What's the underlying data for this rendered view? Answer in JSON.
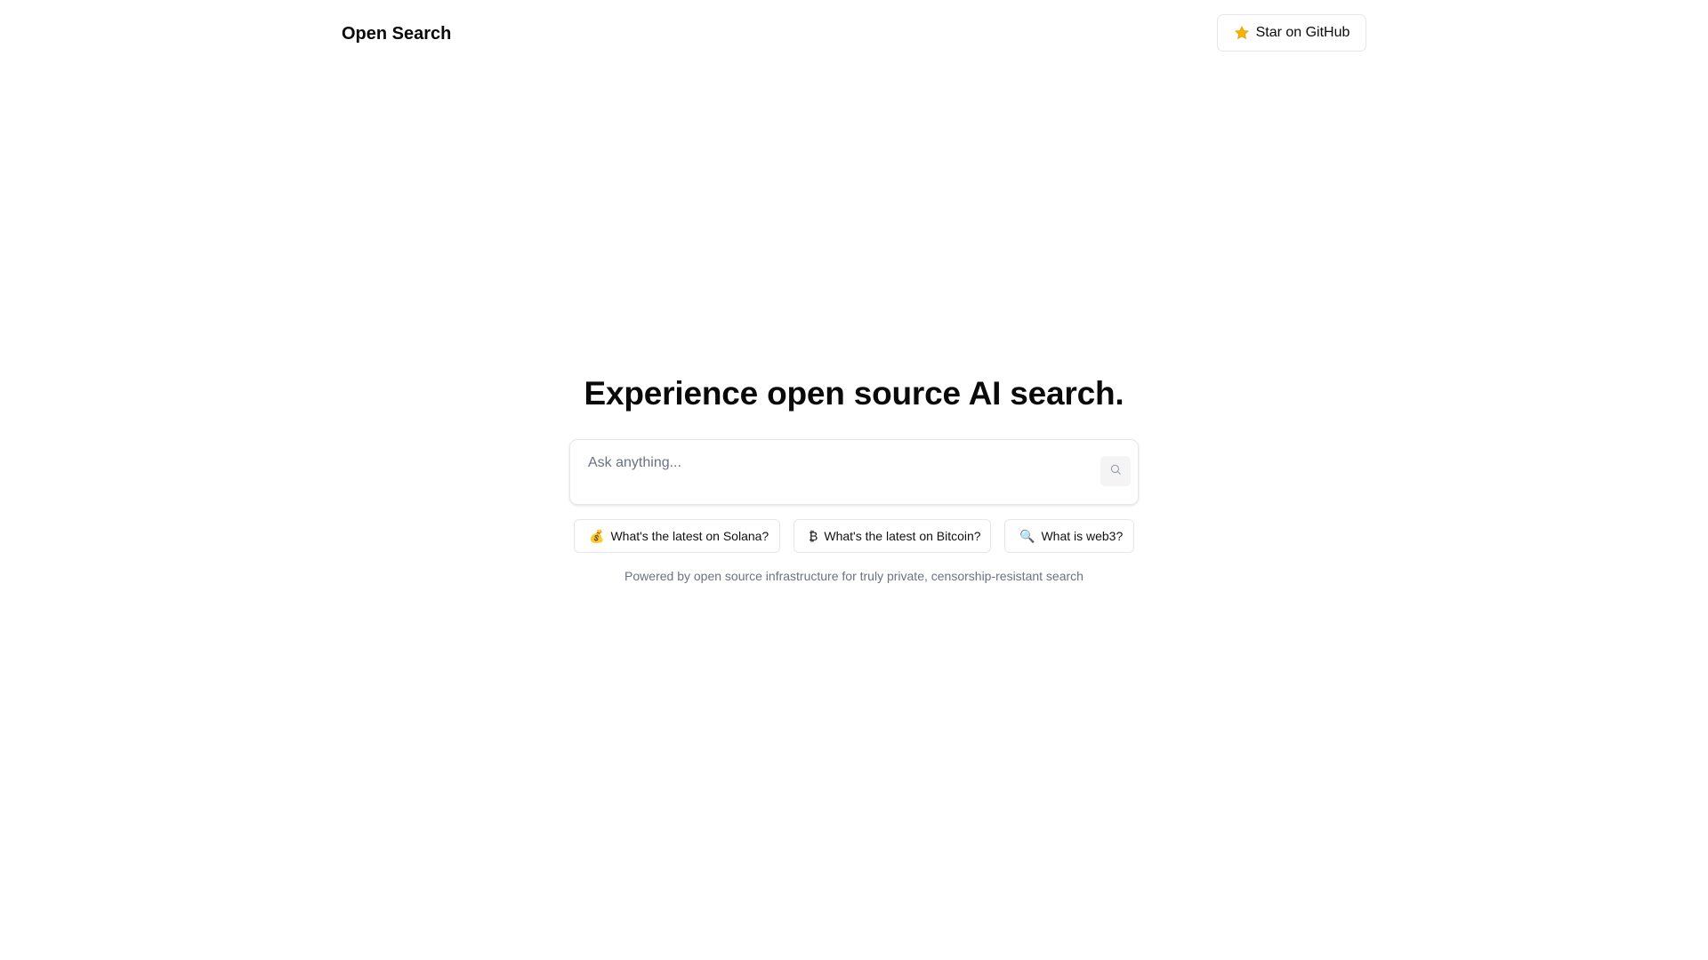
{
  "header": {
    "brand": "Open Search",
    "github_button": {
      "icon": "star-icon",
      "label": "Star on GitHub"
    }
  },
  "hero": {
    "title": "Experience open source AI search."
  },
  "search": {
    "placeholder": "Ask anything...",
    "value": "",
    "submit_icon": "search-icon"
  },
  "suggestions": [
    {
      "emoji": "💰",
      "label": "What's the latest on Solana?"
    },
    {
      "emoji": "₿",
      "label": "What's the latest on Bitcoin?"
    },
    {
      "emoji": "🔍",
      "label": "What is web3?"
    }
  ],
  "footnote": "Powered by open source infrastructure for truly private, censorship-resistant search",
  "colors": {
    "background": "#ffffff",
    "text": "#0a0a0a",
    "muted_text": "#6b7280",
    "border": "#e5e7eb",
    "star": "#f5b400"
  }
}
